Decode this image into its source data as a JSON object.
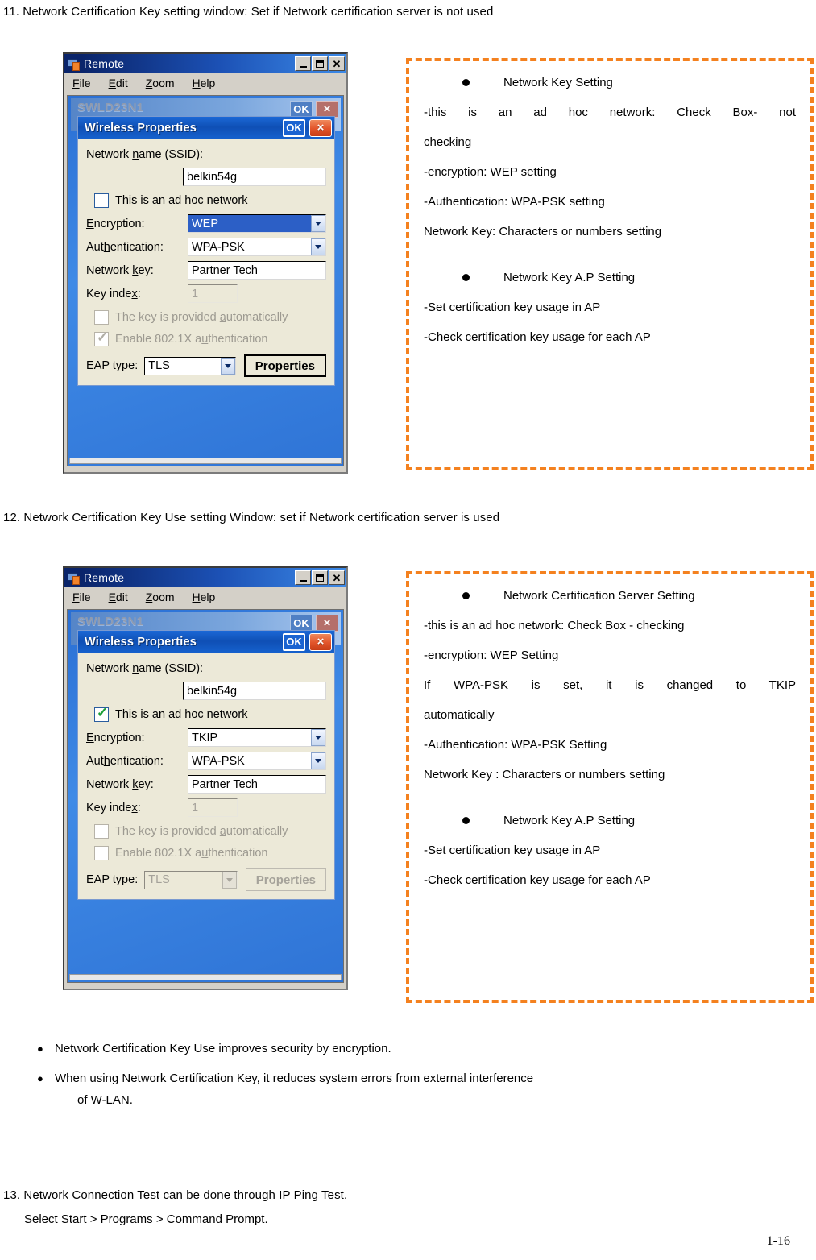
{
  "document": {
    "heading_11": "11. Network Certification Key setting window: Set if Network certification server is not used",
    "heading_12": "12. Network Certification Key Use setting Window: set if Network certification server is used",
    "heading_13": "13. Network Connection Test can be done through IP Ping Test.",
    "subline_13": "Select Start > Programs > Command Prompt.",
    "page_number": "1-16"
  },
  "colors": {
    "callout_border": "#F4811F",
    "titlebar_blue": "#0A246A",
    "dialog_blue": "#0F4FB5",
    "close_red": "#E2542A",
    "check_green": "#1A9E35",
    "select_blue": "#2C5FC6"
  },
  "remote_window": {
    "title": "Remote",
    "menu": [
      {
        "label": "File",
        "accel": "F"
      },
      {
        "label": "Edit",
        "accel": "E"
      },
      {
        "label": "Zoom",
        "accel": "Z"
      },
      {
        "label": "Help",
        "accel": "H"
      }
    ],
    "window_buttons": {
      "minimize": "minimize-icon",
      "maximize": "maximize-icon",
      "close": "close-icon"
    }
  },
  "back_window": {
    "title": "SWLD23N1",
    "ok_label": "OK",
    "close_label": "×"
  },
  "dialog_common": {
    "title": "Wireless Properties",
    "ok_label": "OK",
    "close_label": "×",
    "labels": {
      "ssid": "Network name (SSID):",
      "adhoc": "This is an ad hoc network",
      "encryption": "Encryption:",
      "authentication": "Authentication:",
      "network_key": "Network key:",
      "key_index": "Key index:",
      "key_auto": "The key is provided automatically",
      "enable_8021x": "Enable 802.1X authentication",
      "eap_type": "EAP type:",
      "properties_button": "Properties"
    }
  },
  "dialog_1": {
    "ssid_value": "belkin54g",
    "adhoc_checked": false,
    "encryption_value": "WEP",
    "encryption_selected": true,
    "authentication_value": "WPA-PSK",
    "network_key_value": "Partner Tech",
    "key_index_value": "1",
    "key_auto_checked": false,
    "enable_8021x_checked": true,
    "eap_type_value": "TLS",
    "eap_enabled": true
  },
  "dialog_2": {
    "ssid_value": "belkin54g",
    "adhoc_checked": true,
    "encryption_value": "TKIP",
    "encryption_selected": false,
    "authentication_value": "WPA-PSK",
    "network_key_value": "Partner Tech",
    "key_index_value": "1",
    "key_auto_checked": false,
    "enable_8021x_checked": false,
    "eap_type_value": "TLS",
    "eap_enabled": false
  },
  "callout_1": {
    "section_1_title": "Network Key Setting",
    "section_1_lines": [
      "-this is an ad hoc network: Check Box- not",
      "checking",
      "-encryption: WEP setting",
      "-Authentication:   WPA-PSK setting",
      "Network Key: Characters or numbers setting"
    ],
    "section_2_title": "Network Key A.P Setting",
    "section_2_lines": [
      "-Set certification key usage in AP",
      "-Check certification key usage for each AP"
    ]
  },
  "callout_2": {
    "section_1_title": "Network Certification Server Setting",
    "section_1_lines": [
      "-this is an ad hoc network: Check Box - checking",
      "-encryption: WEP Setting",
      " If WPA-PSK is set, it is changed to TKIP",
      "automatically",
      "-Authentication:   WPA-PSK Setting",
      "Network Key : Characters or numbers setting"
    ],
    "section_2_title": "Network Key A.P Setting",
    "section_2_lines": [
      "-Set certification key usage in AP",
      "-Check certification key usage for each AP"
    ]
  },
  "summary_bullets": [
    {
      "text": "Network Certification Key Use improves security by encryption.",
      "continuation": ""
    },
    {
      "text": "When using Network Certification Key, it reduces system errors from external interference",
      "continuation": "of W-LAN."
    }
  ]
}
